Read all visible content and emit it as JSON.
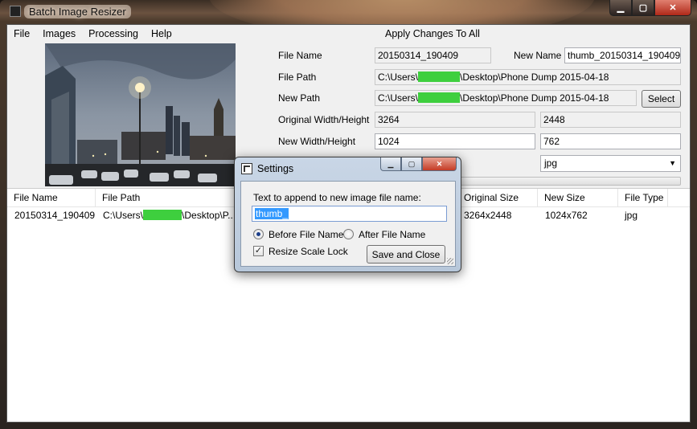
{
  "window": {
    "title": "Batch Image Resizer"
  },
  "menu": {
    "items": [
      "File",
      "Images",
      "Processing",
      "Help"
    ],
    "apply_all": "Apply Changes To All"
  },
  "details": {
    "file_name_label": "File Name",
    "file_name_value": "20150314_190409",
    "new_name_label": "New Name",
    "new_name_value": "thumb_20150314_190409",
    "file_path_label": "File Path",
    "file_path_prefix": "C:\\Users\\",
    "file_path_suffix": "\\Desktop\\Phone Dump 2015-04-18",
    "new_path_label": "New Path",
    "new_path_prefix": "C:\\Users\\",
    "new_path_suffix": "\\Desktop\\Phone Dump 2015-04-18",
    "select_button": "Select",
    "orig_wh_label": "Original Width/Height",
    "orig_width": "3264",
    "orig_height": "2448",
    "new_wh_label": "New Width/Height",
    "new_width": "1024",
    "new_height": "762",
    "file_type_value": "jpg"
  },
  "grid": {
    "columns": [
      "File Name",
      "File Path",
      "Original Size",
      "New Size",
      "File Type"
    ],
    "rows": [
      {
        "file_name": "20150314_190409",
        "file_path_prefix": "C:\\Users\\",
        "file_path_suffix": "\\Desktop\\P...",
        "original_size": "3264x2448",
        "new_size": "1024x762",
        "file_type": "jpg"
      }
    ]
  },
  "settings_dialog": {
    "title": "Settings",
    "append_label": "Text to append to new image file name:",
    "append_value": "thumb_",
    "before_label": "Before File Name",
    "after_label": "After File Name",
    "position_selected": "before",
    "scale_lock_label": "Resize Scale Lock",
    "scale_lock_checked": true,
    "save_button": "Save and Close"
  },
  "colors": {
    "redaction": "#3ecf3e",
    "selection": "#3399ff",
    "dialog_frame": "#c9d6e6"
  }
}
